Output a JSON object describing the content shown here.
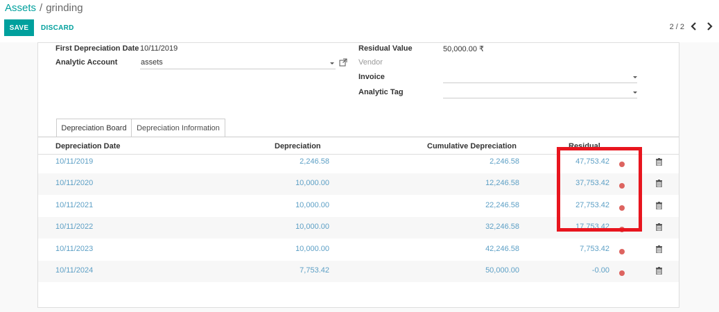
{
  "breadcrumb": {
    "parent": "Assets",
    "separator": "/",
    "current": "grinding"
  },
  "toolbar": {
    "save_label": "SAVE",
    "discard_label": "DISCARD"
  },
  "pager": {
    "text": "2 / 2"
  },
  "form": {
    "first_depreciation_date_label": "First Depreciation Date",
    "first_depreciation_date": "10/11/2019",
    "analytic_account_label": "Analytic Account",
    "analytic_account": "assets",
    "residual_value_label": "Residual Value",
    "residual_value": "50,000.00 ₹",
    "vendor_label": "Vendor",
    "invoice_label": "Invoice",
    "invoice_value": "",
    "analytic_tag_label": "Analytic Tag",
    "analytic_tag_value": ""
  },
  "tabs": [
    {
      "label": "Depreciation Board",
      "active": true
    },
    {
      "label": "Depreciation Information",
      "active": false
    }
  ],
  "table": {
    "headers": [
      "Depreciation Date",
      "Depreciation",
      "Cumulative Depreciation",
      "Residual"
    ],
    "rows": [
      {
        "date": "10/11/2019",
        "depreciation": "2,246.58",
        "cumulative": "2,246.58",
        "residual": "47,753.42"
      },
      {
        "date": "10/11/2020",
        "depreciation": "10,000.00",
        "cumulative": "12,246.58",
        "residual": "37,753.42"
      },
      {
        "date": "10/11/2021",
        "depreciation": "10,000.00",
        "cumulative": "22,246.58",
        "residual": "27,753.42"
      },
      {
        "date": "10/11/2022",
        "depreciation": "10,000.00",
        "cumulative": "32,246.58",
        "residual": "17,753.42"
      },
      {
        "date": "10/11/2023",
        "depreciation": "10,000.00",
        "cumulative": "42,246.58",
        "residual": "7,753.42"
      },
      {
        "date": "10/11/2024",
        "depreciation": "7,753.42",
        "cumulative": "50,000.00",
        "residual": "-0.00"
      }
    ]
  },
  "colors": {
    "accent": "#00a09d",
    "link": "#5c9fc5",
    "status_dot": "#d9534f",
    "highlight": "#e8151e"
  },
  "icons": {
    "external_link": "external-link-icon",
    "dropdown": "caret-down-icon",
    "delete": "trash-icon",
    "prev": "chevron-left-icon",
    "next": "chevron-right-icon"
  }
}
